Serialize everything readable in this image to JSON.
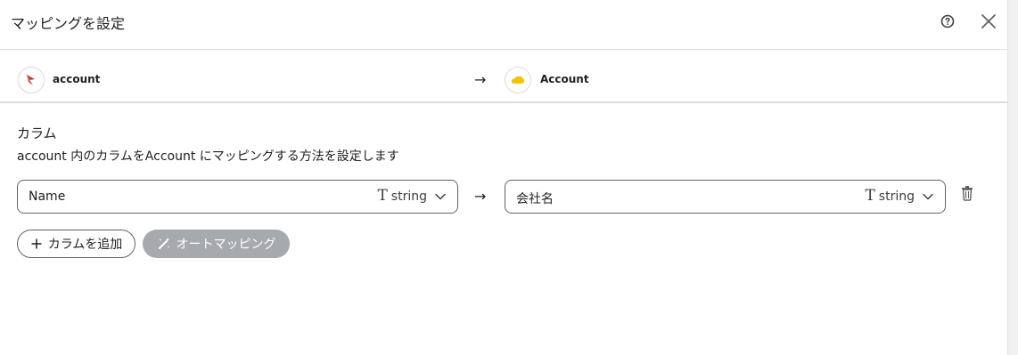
{
  "dialog": {
    "title": "マッピングを設定",
    "help_icon": "help-circle-icon",
    "close_icon": "close-icon"
  },
  "mapping_header": {
    "source": {
      "label": "account",
      "icon": "salesforce-source-logo-icon"
    },
    "arrow": "→",
    "target": {
      "label": "Account",
      "icon": "yellow-cloud-logo-icon"
    }
  },
  "columns": {
    "title": "カラム",
    "description": "account 内のカラムをAccount にマッピングする方法を設定します"
  },
  "rows": [
    {
      "source_field": "Name",
      "source_type": "string",
      "arrow": "→",
      "target_field": "会社名",
      "target_type": "string"
    }
  ],
  "buttons": {
    "add_column": "カラムを追加",
    "auto_mapping": "オートマッピング"
  },
  "colors": {
    "border": "#5f6368",
    "divider": "#dadce0",
    "auto_button_bg": "#a6a9ad",
    "source_logo": "#c0392b",
    "target_logo": "#f2c500"
  }
}
